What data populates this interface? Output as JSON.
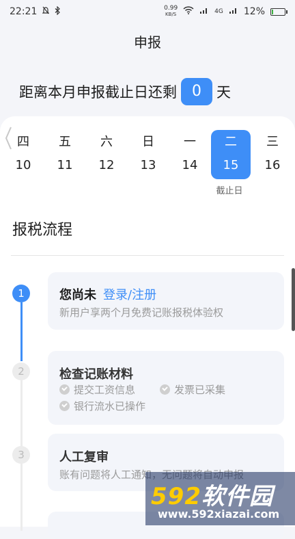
{
  "status_bar": {
    "time": "22:21",
    "net_speed": "0.99",
    "net_unit": "KB/S",
    "signal_label": "4G",
    "battery": "12%",
    "battery_level": 0.12
  },
  "page": {
    "title": "申报"
  },
  "countdown": {
    "prefix": "距离本月申报截止日还剩",
    "days": "0",
    "suffix": "天"
  },
  "calendar": {
    "days": [
      {
        "weekday": "四",
        "date": "10"
      },
      {
        "weekday": "五",
        "date": "11"
      },
      {
        "weekday": "六",
        "date": "12"
      },
      {
        "weekday": "日",
        "date": "13"
      },
      {
        "weekday": "一",
        "date": "14"
      },
      {
        "weekday": "二",
        "date": "15"
      },
      {
        "weekday": "三",
        "date": "16"
      }
    ],
    "selected_index": 5,
    "deadline_label": "截止日"
  },
  "process": {
    "title": "报税流程",
    "steps": [
      {
        "num": "1",
        "title": "您尚未",
        "link": "登录/注册",
        "subtitle": "新用户享两个月免费记账报税体验权"
      },
      {
        "num": "2",
        "title": "检查记账材料",
        "items": [
          "提交工资信息",
          "发票已采集",
          "银行流水已操作"
        ]
      },
      {
        "num": "3",
        "title": "人工复审",
        "subtitle": "账有问题将人工通知，无问题将自动申报"
      }
    ]
  },
  "watermark": {
    "logo_num": "592",
    "logo_text": "软件园",
    "url": "www.592xiazai.com"
  },
  "colors": {
    "accent": "#3e8ef7",
    "background": "#f4f5f9",
    "card": "#ffffff"
  }
}
